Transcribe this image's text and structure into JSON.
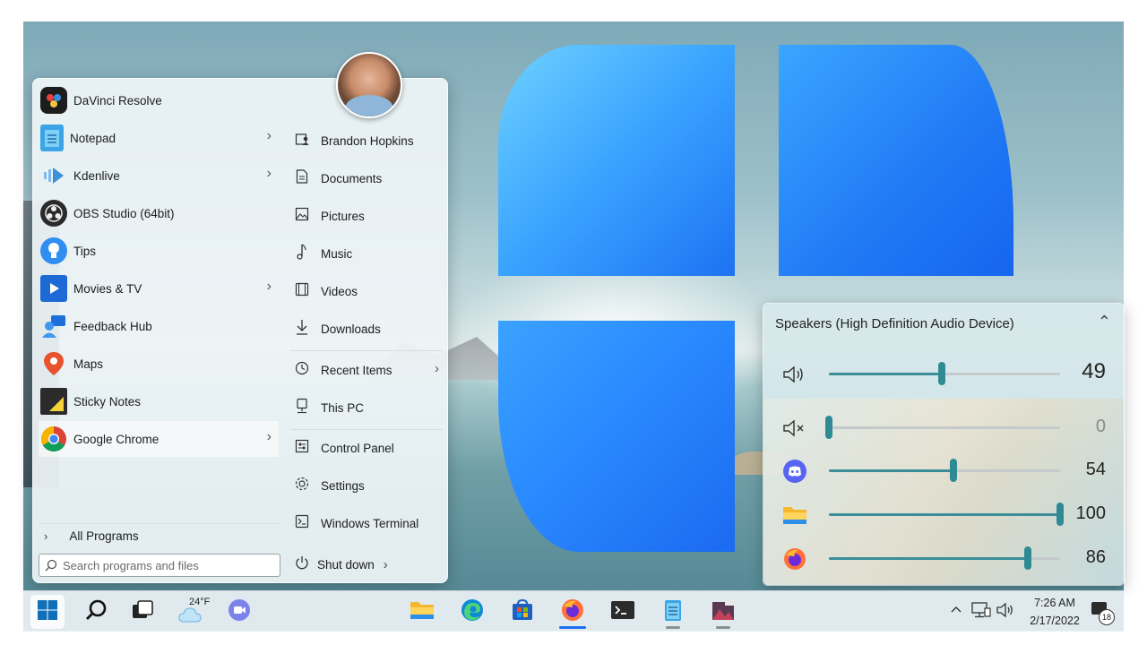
{
  "start_menu": {
    "programs": [
      {
        "label": "DaVinci Resolve",
        "icon": "davinci-resolve-icon",
        "has_submenu": false
      },
      {
        "label": "Notepad",
        "icon": "notepad-icon",
        "has_submenu": true
      },
      {
        "label": "Kdenlive",
        "icon": "kdenlive-icon",
        "has_submenu": true
      },
      {
        "label": "OBS Studio (64bit)",
        "icon": "obs-studio-icon",
        "has_submenu": false
      },
      {
        "label": "Tips",
        "icon": "tips-icon",
        "has_submenu": false
      },
      {
        "label": "Movies & TV",
        "icon": "movies-tv-icon",
        "has_submenu": true
      },
      {
        "label": "Feedback Hub",
        "icon": "feedback-hub-icon",
        "has_submenu": false
      },
      {
        "label": "Maps",
        "icon": "maps-icon",
        "has_submenu": false
      },
      {
        "label": "Sticky Notes",
        "icon": "sticky-notes-icon",
        "has_submenu": false
      },
      {
        "label": "Google Chrome",
        "icon": "chrome-icon",
        "has_submenu": true
      }
    ],
    "all_programs": "All Programs",
    "search_placeholder": "Search programs and files",
    "places": [
      {
        "label": "Brandon Hopkins",
        "icon": "user-folder-icon"
      },
      {
        "label": "Documents",
        "icon": "document-icon"
      },
      {
        "label": "Pictures",
        "icon": "picture-icon"
      },
      {
        "label": "Music",
        "icon": "music-note-icon"
      },
      {
        "label": "Videos",
        "icon": "film-icon"
      },
      {
        "label": "Downloads",
        "icon": "download-icon"
      },
      {
        "label": "Recent Items",
        "icon": "clock-icon"
      },
      {
        "label": "This PC",
        "icon": "computer-icon"
      },
      {
        "label": "Control Panel",
        "icon": "control-panel-icon"
      },
      {
        "label": "Settings",
        "icon": "gear-icon"
      },
      {
        "label": "Windows Terminal",
        "icon": "terminal-icon"
      }
    ],
    "shutdown": "Shut down"
  },
  "volume_mixer": {
    "device": "Speakers (High Definition Audio Device)",
    "master": {
      "icon": "speaker-icon",
      "value": "49",
      "level": 0.49
    },
    "apps": [
      {
        "icon": "muted-speaker-icon",
        "value": "0",
        "level": 0.0
      },
      {
        "icon": "discord-icon",
        "value": "54",
        "level": 0.54
      },
      {
        "icon": "file-explorer-icon",
        "value": "100",
        "level": 1.0
      },
      {
        "icon": "firefox-icon",
        "value": "86",
        "level": 0.86
      }
    ]
  },
  "taskbar": {
    "weather_temp": "24°F",
    "time": "7:26 AM",
    "date": "2/17/2022",
    "notification_count": "18",
    "accent": "#1c6ef2"
  }
}
